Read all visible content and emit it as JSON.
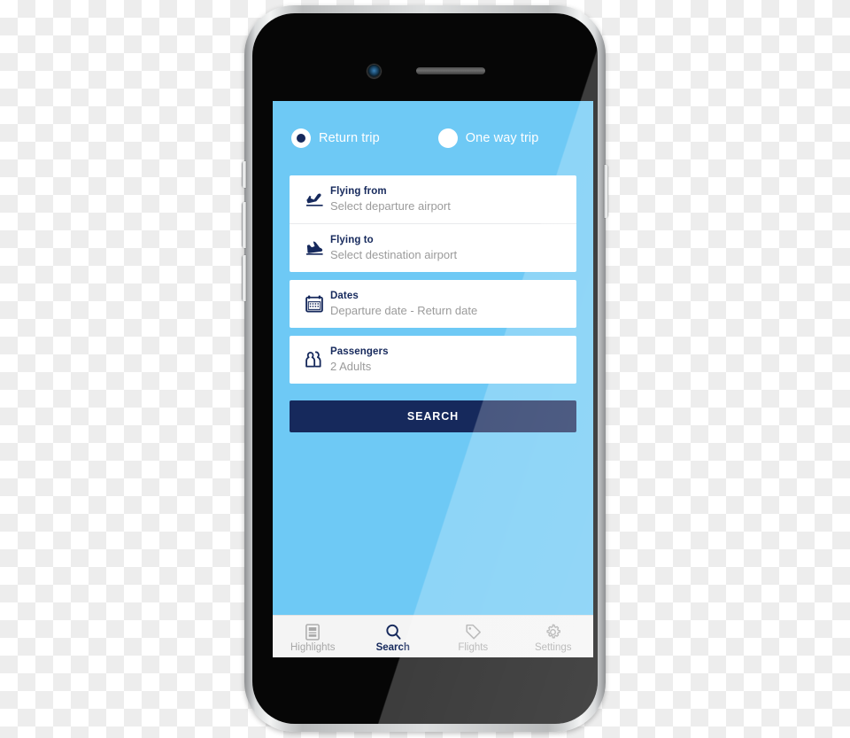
{
  "device": {
    "name": "smartphone-mockup",
    "camera": "front-camera",
    "speaker": "earpiece-speaker"
  },
  "app": {
    "background_color": "#6ec9f5",
    "accent_color": "#16295c",
    "trip_types": [
      {
        "label": "Return trip",
        "selected": true,
        "icon": "radio-selected-icon"
      },
      {
        "label": "One way trip",
        "selected": false,
        "icon": "radio-unselected-icon"
      }
    ],
    "fields": [
      {
        "key": "flying-from",
        "title": "Flying from",
        "value": "Select departure airport",
        "icon": "plane-takeoff-icon"
      },
      {
        "key": "flying-to",
        "title": "Flying to",
        "value": "Select destination airport",
        "icon": "plane-landing-icon"
      },
      {
        "key": "dates",
        "title": "Dates",
        "value": "Departure date - Return date",
        "icon": "calendar-icon"
      },
      {
        "key": "passengers",
        "title": "Passengers",
        "value": "2 Adults",
        "icon": "passengers-icon"
      }
    ],
    "search_button": {
      "label": "SEARCH"
    },
    "bottom_nav": [
      {
        "label": "Highlights",
        "icon": "highlights-icon",
        "active": false
      },
      {
        "label": "Search",
        "icon": "search-icon",
        "active": true
      },
      {
        "label": "Flights",
        "icon": "tag-icon",
        "active": false
      },
      {
        "label": "Settings",
        "icon": "gear-icon",
        "active": false
      }
    ]
  }
}
